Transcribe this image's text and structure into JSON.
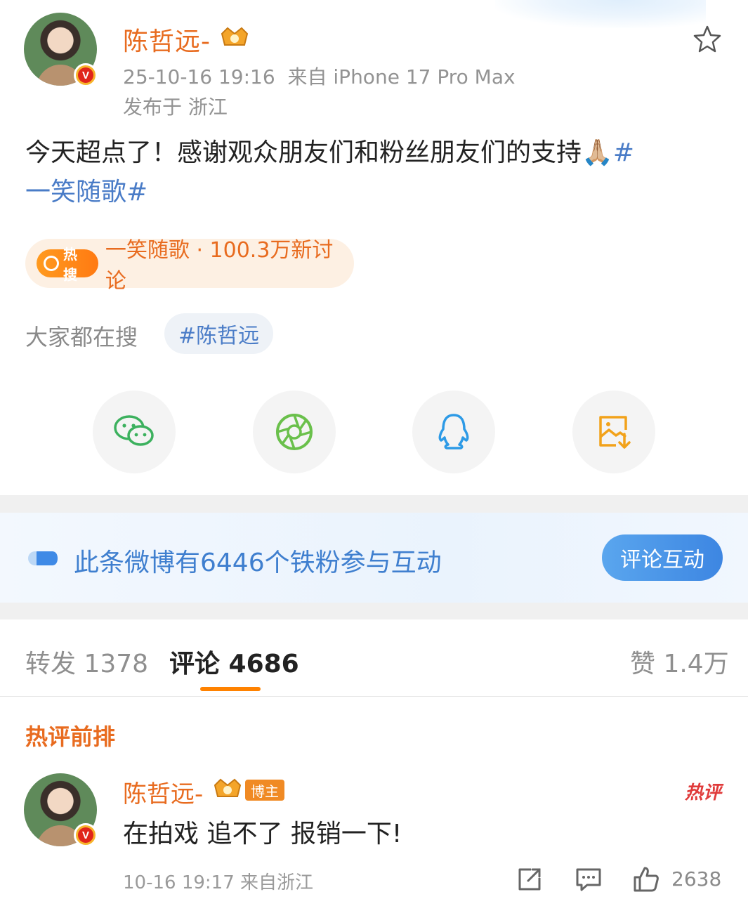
{
  "post": {
    "author": "陈哲远-",
    "timestamp": "25-10-16 19:16",
    "source": "来自 iPhone 17 Pro Max",
    "location": "发布于 浙江",
    "text": "今天超点了！感谢观众朋友们和粉丝朋友们的支持🙏🏼",
    "hashtag_start": "#",
    "hashtag_rest": "一笑随歌#"
  },
  "hot_search": {
    "chip": "热搜",
    "text": "一笑随歌 · 100.3万新讨论"
  },
  "everyone_search": {
    "label": "大家都在搜",
    "chip": "#陈哲远"
  },
  "fans": {
    "text": "此条微博有6446个铁粉参与互动",
    "button": "评论互动"
  },
  "tabs": {
    "repost": "转发 1378",
    "comment": "评论 4686",
    "like": "赞 1.4万"
  },
  "section_title": "热评前排",
  "comment": {
    "author": "陈哲远-",
    "badge": "博主",
    "hot_label": "热评",
    "text": "在拍戏 追不了 报销一下!",
    "meta": "10-16 19:17 来自浙江",
    "likes": "2638"
  },
  "badge_glyph": "V",
  "colors": {
    "accent": "#e86b1f",
    "link": "#4a7cc7",
    "tab_underline": "#ff8200"
  }
}
